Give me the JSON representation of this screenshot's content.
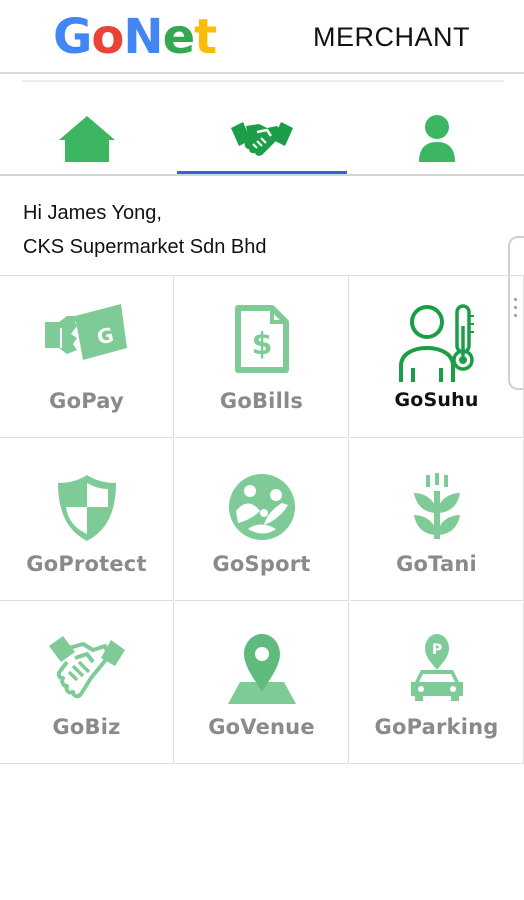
{
  "header": {
    "logo_letters": [
      "G",
      "o",
      "N",
      "e",
      "t"
    ],
    "logo_colors": [
      "#4285F4",
      "#EA4335",
      "#4285F4",
      "#34A853",
      "#FBBC05"
    ],
    "merchant_label": "MERCHANT"
  },
  "tabs": [
    {
      "icon": "home-icon",
      "active": false
    },
    {
      "icon": "handshake-icon",
      "active": true
    },
    {
      "icon": "user-icon",
      "active": false
    }
  ],
  "greeting": {
    "line1": "Hi James Yong,",
    "line2": "CKS Supermarket Sdn Bhd"
  },
  "services": [
    {
      "label": "GoPay",
      "icon": "wallet-icon"
    },
    {
      "label": "GoBills",
      "icon": "bill-icon"
    },
    {
      "label": "GoSuhu",
      "icon": "thermometer-person-icon"
    },
    {
      "label": "GoProtect",
      "icon": "shield-icon"
    },
    {
      "label": "GoSport",
      "icon": "sport-icon"
    },
    {
      "label": "GoTani",
      "icon": "plant-icon"
    },
    {
      "label": "GoBiz",
      "icon": "handshake-icon"
    },
    {
      "label": "GoVenue",
      "icon": "location-pin-icon"
    },
    {
      "label": "GoParking",
      "icon": "parking-car-icon"
    }
  ],
  "colors": {
    "accent_green": "#34A853",
    "light_green": "#7FCB97",
    "tab_underline": "#2F66D0"
  }
}
